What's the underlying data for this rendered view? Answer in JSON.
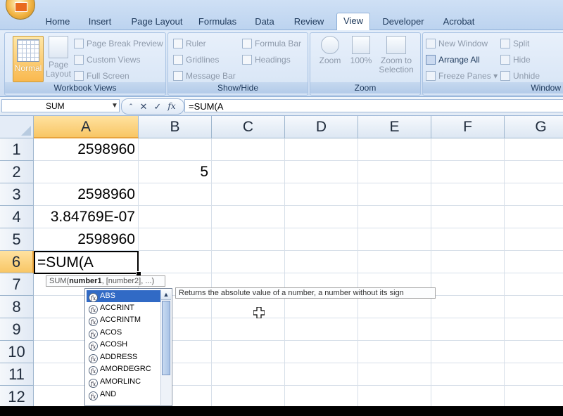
{
  "ribbon": {
    "tabs": [
      {
        "label": "Home"
      },
      {
        "label": "Insert"
      },
      {
        "label": "Page Layout"
      },
      {
        "label": "Formulas"
      },
      {
        "label": "Data"
      },
      {
        "label": "Review"
      },
      {
        "label": "View"
      },
      {
        "label": "Developer"
      },
      {
        "label": "Acrobat"
      }
    ],
    "active_tab": "View",
    "workbook_views": {
      "normal": "Normal",
      "page_layout": "Page Layout",
      "page_break_preview": "Page Break Preview",
      "custom_views": "Custom Views",
      "full_screen": "Full Screen",
      "group_label": "Workbook Views"
    },
    "show_hide": {
      "ruler": "Ruler",
      "gridlines": "Gridlines",
      "message_bar": "Message Bar",
      "formula_bar": "Formula Bar",
      "headings": "Headings",
      "group_label": "Show/Hide"
    },
    "zoom": {
      "zoom": "Zoom",
      "hundred": "100%",
      "zoom_to_selection": "Zoom to Selection",
      "group_label": "Zoom"
    },
    "window": {
      "new_window": "New Window",
      "arrange_all": "Arrange All",
      "freeze_panes": "Freeze Panes",
      "split": "Split",
      "hide": "Hide",
      "unhide": "Unhide",
      "group_label": "Window"
    }
  },
  "formula_bar": {
    "name_box": "SUM",
    "fx": "fx",
    "formula": "=SUM(A"
  },
  "grid": {
    "columns": [
      "A",
      "B",
      "C",
      "D",
      "E",
      "F",
      "G"
    ],
    "rows": [
      "1",
      "2",
      "3",
      "4",
      "5",
      "6",
      "7",
      "8",
      "9",
      "10",
      "11",
      "12"
    ],
    "cells": {
      "A1": "2598960",
      "B2": "5",
      "A3": "2598960",
      "A4": "3.84769E-07",
      "A5": "2598960",
      "A6": "=SUM(A"
    }
  },
  "argument_tooltip": {
    "func": "SUM(",
    "arg1": "number1",
    "rest": ", [number2], ...)"
  },
  "autocomplete": {
    "items": [
      "ABS",
      "ACCRINT",
      "ACCRINTM",
      "ACOS",
      "ACOSH",
      "ADDRESS",
      "AMORDEGRC",
      "AMORLINC",
      "AND"
    ],
    "selected": "ABS",
    "description": "Returns the absolute value of a number, a number without its sign"
  }
}
